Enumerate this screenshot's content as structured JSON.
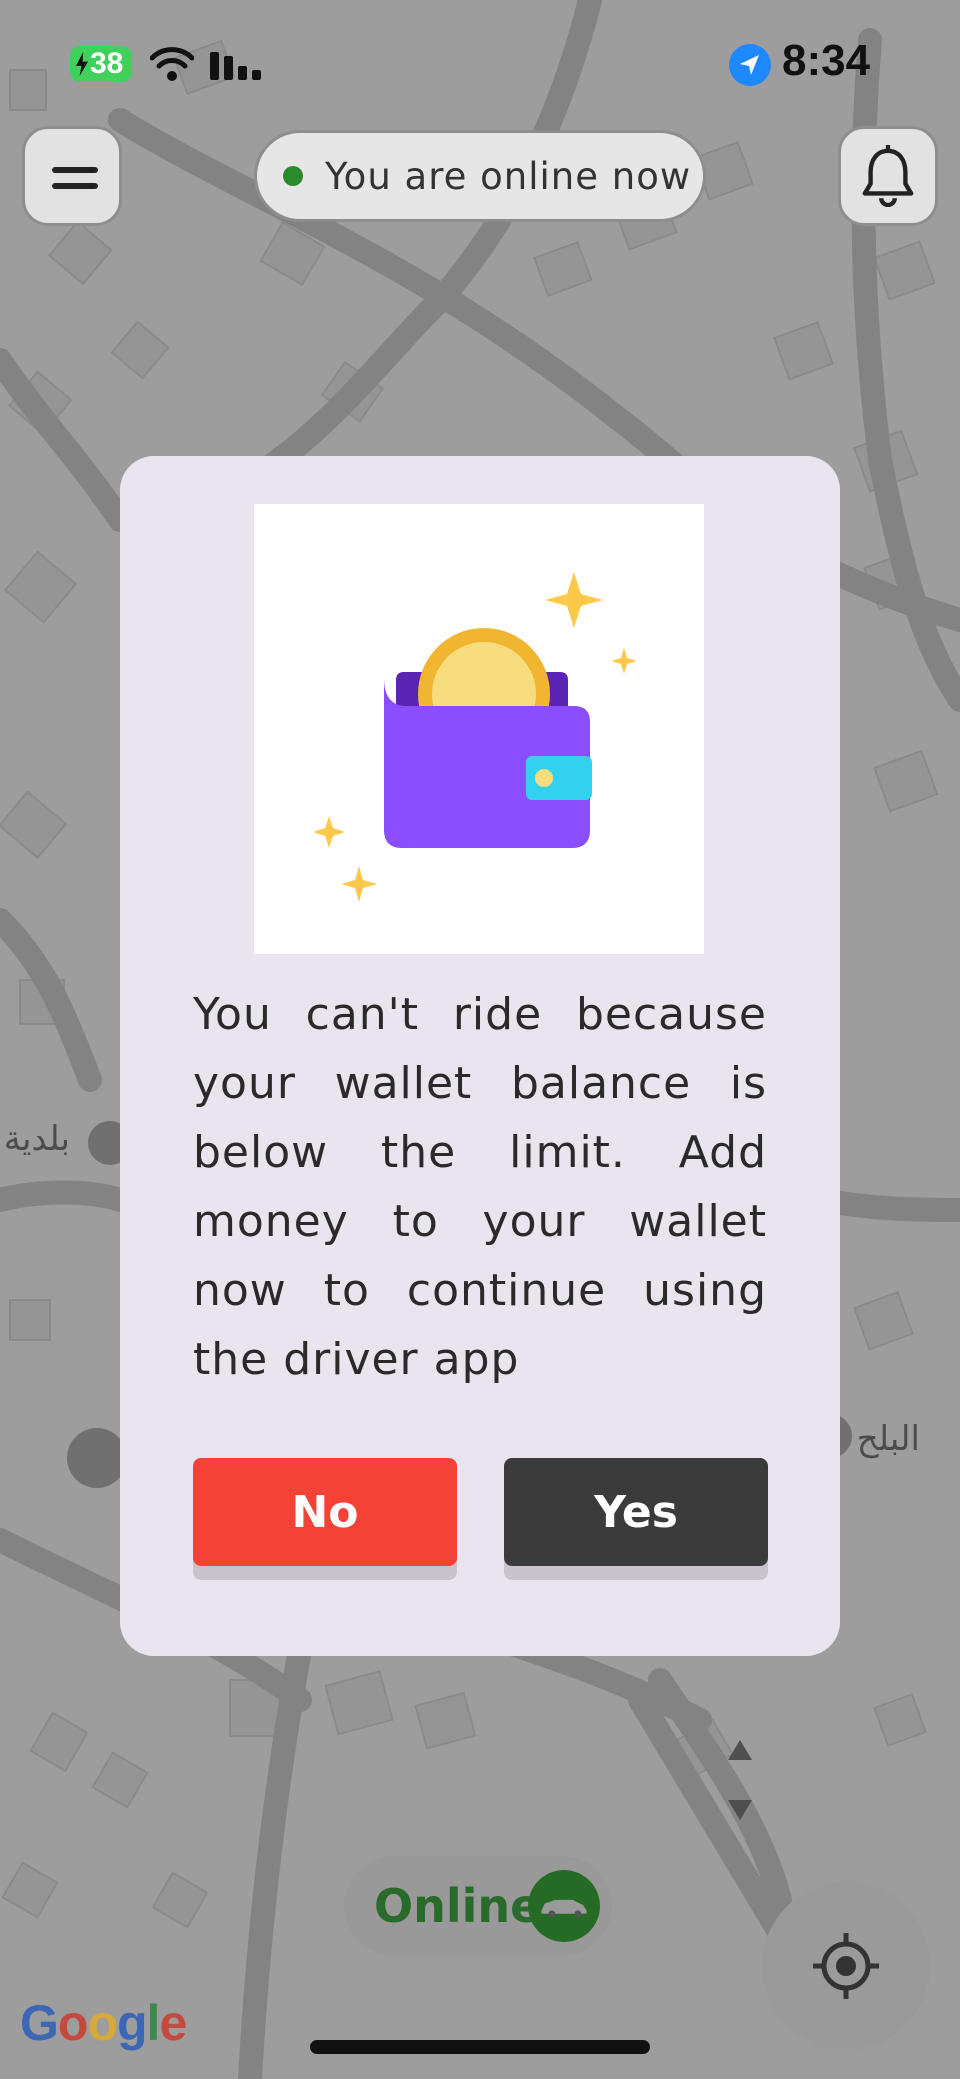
{
  "status_bar": {
    "battery": "38",
    "time": "8:34"
  },
  "header": {
    "online_status": "You are online now"
  },
  "dialog": {
    "message": "You can't ride because your wallet balance is below the limit. Add money to your wallet now to continue using the driver app",
    "no_label": "No",
    "yes_label": "Yes",
    "illustration_icon": "wallet-coin-icon"
  },
  "bottom": {
    "toggle_label": "Online",
    "google_logo": "Google"
  },
  "colors": {
    "no_button": "#f44336",
    "yes_button": "#3b3b3b",
    "online_green": "#2c8a2c",
    "dialog_bg": "#e9e4ed",
    "wallet_purple": "#8a4dff"
  }
}
